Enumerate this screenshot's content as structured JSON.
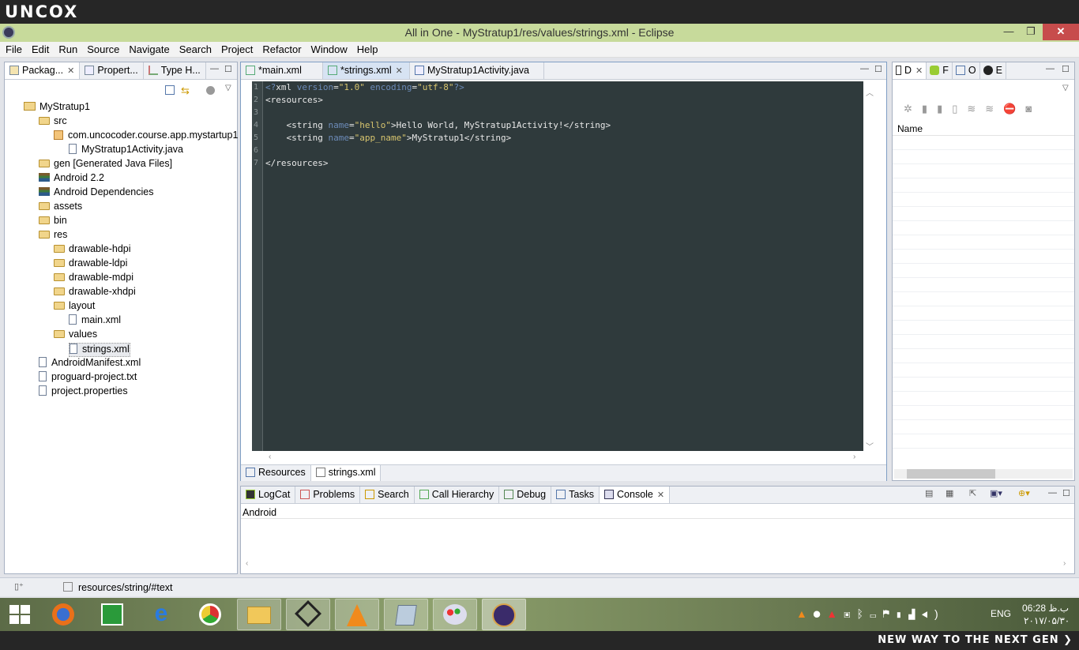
{
  "brand": "UNCOX",
  "window": {
    "title": "All in One - MyStratup1/res/values/strings.xml - Eclipse",
    "minimize": "—",
    "restore": "❐",
    "close": "✕"
  },
  "menu": [
    "File",
    "Edit",
    "Run",
    "Source",
    "Navigate",
    "Search",
    "Project",
    "Refactor",
    "Window",
    "Help"
  ],
  "left_panel": {
    "tabs": [
      "Packag...",
      "Propert...",
      "Type H..."
    ],
    "tree": [
      {
        "label": "MyStratup1",
        "icon": "project-icon",
        "indent": 0
      },
      {
        "label": "src",
        "icon": "folder-icon",
        "indent": 1
      },
      {
        "label": "com.uncocoder.course.app.mystartup1",
        "icon": "package-icon",
        "indent": 2
      },
      {
        "label": "MyStratup1Activity.java",
        "icon": "java-file-icon",
        "indent": 3
      },
      {
        "label": "gen [Generated Java Files]",
        "icon": "folder-icon",
        "indent": 1
      },
      {
        "label": "Android 2.2",
        "icon": "library-icon",
        "indent": 1
      },
      {
        "label": "Android Dependencies",
        "icon": "library-icon",
        "indent": 1
      },
      {
        "label": "assets",
        "icon": "folder-icon",
        "indent": 1
      },
      {
        "label": "bin",
        "icon": "folder-icon",
        "indent": 1
      },
      {
        "label": "res",
        "icon": "folder-icon",
        "indent": 1
      },
      {
        "label": "drawable-hdpi",
        "icon": "folder-icon",
        "indent": 2
      },
      {
        "label": "drawable-ldpi",
        "icon": "folder-icon",
        "indent": 2
      },
      {
        "label": "drawable-mdpi",
        "icon": "folder-icon",
        "indent": 2
      },
      {
        "label": "drawable-xhdpi",
        "icon": "folder-icon",
        "indent": 2
      },
      {
        "label": "layout",
        "icon": "folder-icon",
        "indent": 2
      },
      {
        "label": "main.xml",
        "icon": "xml-file-icon",
        "indent": 3
      },
      {
        "label": "values",
        "icon": "folder-icon",
        "indent": 2
      },
      {
        "label": "strings.xml",
        "icon": "xml-file-icon",
        "indent": 3
      },
      {
        "label": "AndroidManifest.xml",
        "icon": "xml-file-icon",
        "indent": 1
      },
      {
        "label": "proguard-project.txt",
        "icon": "text-file-icon",
        "indent": 1
      },
      {
        "label": "project.properties",
        "icon": "text-file-icon",
        "indent": 1
      }
    ]
  },
  "editor": {
    "tabs": [
      "*main.xml",
      "*strings.xml",
      "MyStratup1Activity.java"
    ],
    "line_numbers": [
      "1",
      "2",
      "3",
      "4",
      "5",
      "6",
      "7"
    ],
    "bottom_tabs": [
      "Resources",
      "strings.xml"
    ]
  },
  "right_panel": {
    "tabs": [
      "D",
      "F",
      "O",
      "E"
    ],
    "column_header": "Name"
  },
  "console": {
    "tabs": [
      "LogCat",
      "Problems",
      "Search",
      "Call Hierarchy",
      "Debug",
      "Tasks",
      "Console"
    ],
    "header": "Android"
  },
  "status": {
    "path": "resources/string/#text"
  },
  "tray": {
    "lang": "ENG",
    "time": "06:28 ب.ظ",
    "date": "۲۰۱۷/۰۵/۳۰"
  },
  "slogan": "NEW WAY TO THE NEXT GEN ❯",
  "colors": {
    "titlebar": "#c7da9b",
    "editor_bg": "#2f3a3c",
    "close": "#c74c4c"
  }
}
